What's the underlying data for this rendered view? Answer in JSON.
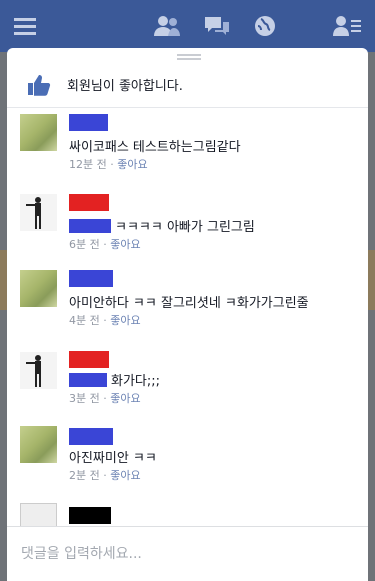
{
  "topbar": {
    "icons": [
      "menu-icon",
      "friends-icon",
      "messages-icon",
      "globe-icon",
      "contacts-icon"
    ]
  },
  "likes": {
    "text": "회원님이 좋아합니다.",
    "icon": "thumbs-up-icon"
  },
  "comments": [
    {
      "avatar": "green-landscape",
      "name_color": "#3a45d6",
      "text": "싸이코패스 테스트하는그림같다",
      "time": "12분 전",
      "like": "좋아요"
    },
    {
      "avatar": "standing-figure",
      "name_color": "#e32222",
      "text": "ㅋㅋㅋㅋ 아빠가 그린그림",
      "time": "6분 전",
      "like": "좋아요"
    },
    {
      "avatar": "green-landscape",
      "name_color": "#3a45d6",
      "text": "아미안하다 ㅋㅋ 잘그리셧네 ㅋ화가가그린줄",
      "time": "4분 전",
      "like": "좋아요"
    },
    {
      "avatar": "standing-figure",
      "name_color": "#e32222",
      "text": "화가다;;;",
      "time": "3분 전",
      "like": "좋아요"
    },
    {
      "avatar": "green-landscape",
      "name_color": "#3a45d6",
      "text": "아진짜미안 ㅋㅋ",
      "time": "2분 전",
      "like": "좋아요"
    },
    {
      "avatar": "document",
      "name_color": "#000000"
    }
  ],
  "composer": {
    "placeholder": "댓글을 입력하세요..."
  },
  "colors": {
    "brand": "#3b5998",
    "link": "#6d84b4",
    "meta": "#9197a3"
  }
}
